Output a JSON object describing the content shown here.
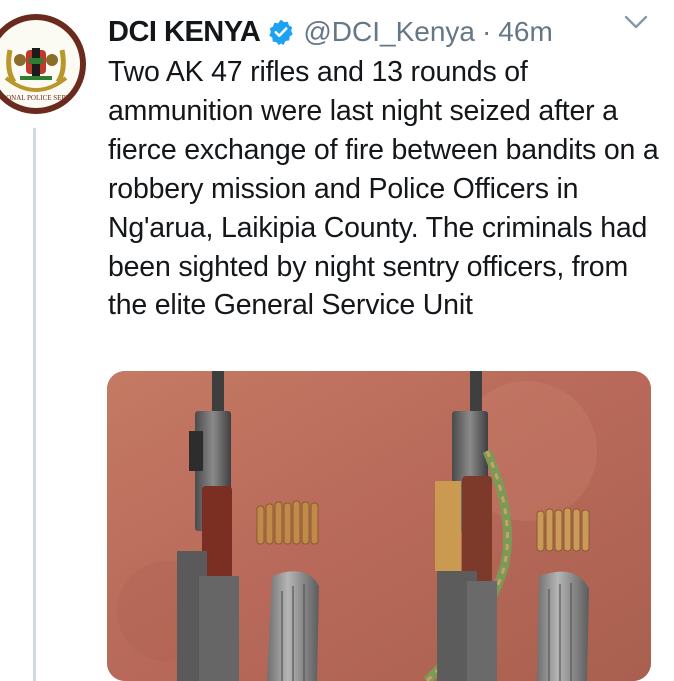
{
  "tweet": {
    "author_name": "DCI KENYA",
    "handle": "@DCI_Kenya",
    "separator": "·",
    "time_ago": "46m",
    "text": "Two AK 47 rifles and 13 rounds of ammunition were last night seized after a fierce exchange of fire between bandits on a robbery mission and Police Officers in Ng'arua, Laikipia County. The criminals had been sighted by night sentry officers, from the elite General Service Unit",
    "avatar_label": "NATIONAL POLICE SERVICE",
    "verified_color": "#1da1f2"
  },
  "icons": {
    "verified": "verified-badge-icon",
    "menu": "chevron-down-icon"
  }
}
